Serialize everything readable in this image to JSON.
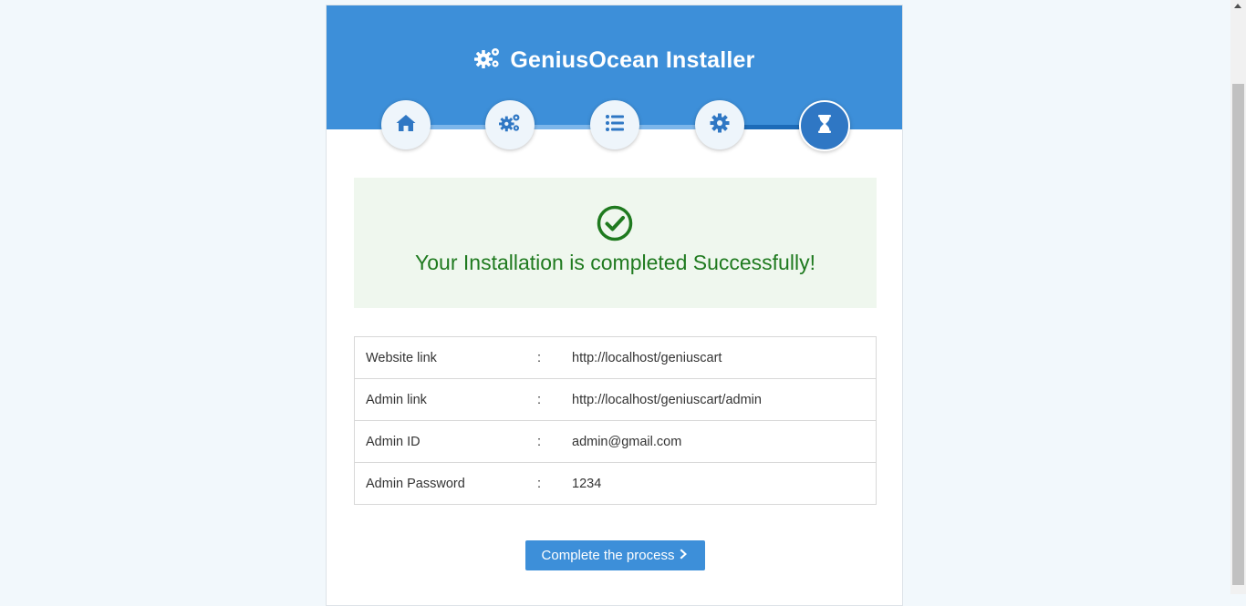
{
  "installer": {
    "title": "GeniusOcean Installer",
    "title_icon": "gears-icon",
    "steps": [
      {
        "icon": "home-icon",
        "state": "done"
      },
      {
        "icon": "gears-icon",
        "state": "done"
      },
      {
        "icon": "list-icon",
        "state": "done"
      },
      {
        "icon": "gear-icon",
        "state": "done"
      },
      {
        "icon": "hourglass-icon",
        "state": "active"
      }
    ]
  },
  "success": {
    "icon": "check-circle-icon",
    "message": "Your Installation is completed Successfully!"
  },
  "details": [
    {
      "label": "Website link",
      "separator": ":",
      "value": "http://localhost/geniuscart"
    },
    {
      "label": "Admin link",
      "separator": ":",
      "value": "http://localhost/geniuscart/admin"
    },
    {
      "label": "Admin ID",
      "separator": ":",
      "value": "admin@gmail.com"
    },
    {
      "label": "Admin Password",
      "separator": ":",
      "value": "1234"
    }
  ],
  "actions": {
    "complete_label": "Complete the process",
    "complete_icon": "chevron-right-icon"
  },
  "colors": {
    "header": "#3d8fd9",
    "step_icon": "#2f77c4",
    "success_bg": "#eff7ee",
    "success_text": "#1f7a1f",
    "button": "#3d8fd9"
  }
}
